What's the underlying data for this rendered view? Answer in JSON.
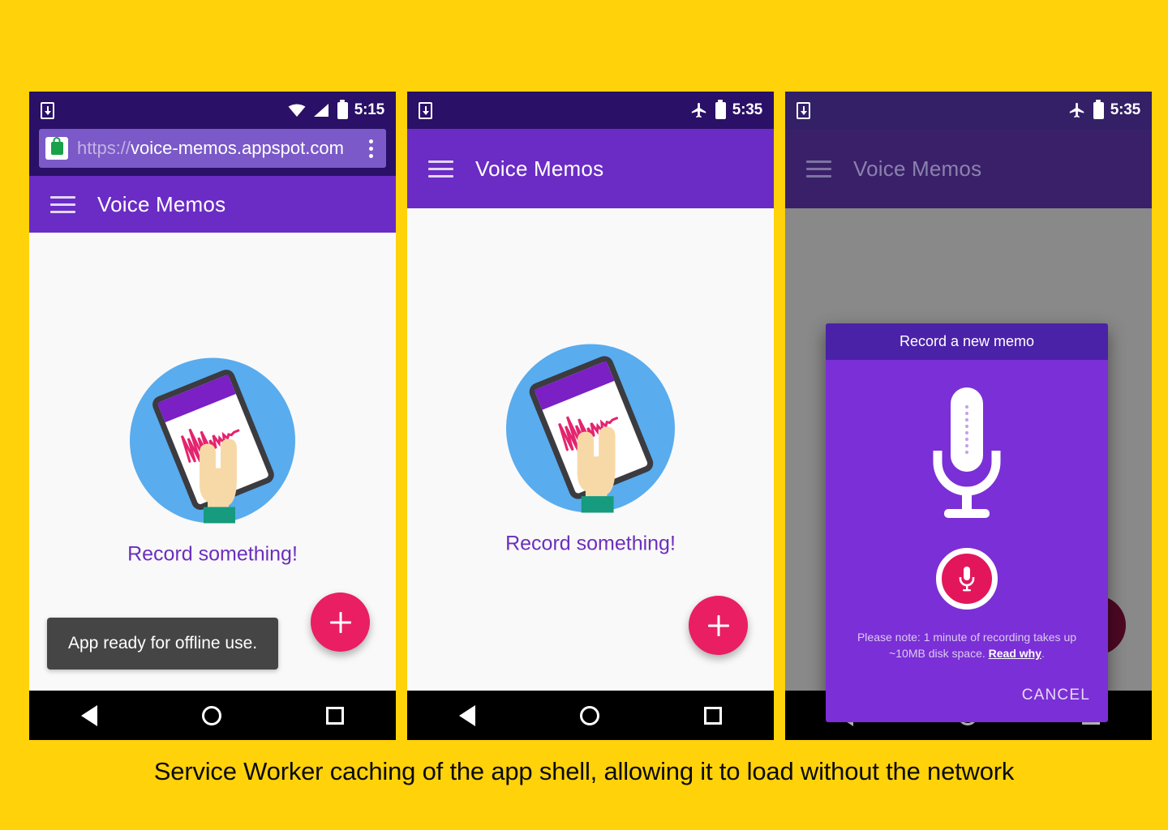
{
  "page": {
    "background_color": "#FFD20A",
    "caption": "Service Worker caching of the app shell, allowing it to load without the network"
  },
  "colors": {
    "yellow": "#FFD20A",
    "app_bar_purple": "#6A2CC4",
    "status_bar_purple": "#2A1066",
    "accent_pink": "#E91E63",
    "dialog_purple": "#7B2FD6",
    "dialog_header_purple": "#4A22A8",
    "toast_gray": "#454545",
    "illustration_blue": "#59ACEE",
    "illustration_wave_pink": "#E3246E",
    "illustration_skin": "#F7D9A8",
    "illustration_cuff_teal": "#169B7E"
  },
  "phones": [
    {
      "id": "phone-browser",
      "status_bar": {
        "download_icon": "download-icon",
        "icons": [
          "wifi-icon",
          "signal-icon",
          "battery-icon"
        ],
        "time": "5:15"
      },
      "browser": {
        "lock_icon": "lock-icon",
        "url_scheme": "https://",
        "url_host": "voice-memos.appspot.com",
        "menu_icon": "kebab-menu-icon"
      },
      "app_bar": {
        "menu_icon": "hamburger-icon",
        "title": "Voice Memos",
        "dimmed": false
      },
      "content": {
        "illustration": "hand-holding-phone-illustration",
        "empty_label": "Record something!"
      },
      "toast": "App ready for offline use.",
      "fab": {
        "icon": "plus-icon",
        "label": "Add memo",
        "dimmed": false
      },
      "dialog": null,
      "nav_bar": [
        "back-icon",
        "home-icon",
        "recents-icon"
      ]
    },
    {
      "id": "phone-offline",
      "status_bar": {
        "download_icon": "download-icon",
        "icons": [
          "airplane-mode-icon",
          "battery-icon"
        ],
        "time": "5:35"
      },
      "browser": null,
      "app_bar": {
        "menu_icon": "hamburger-icon",
        "title": "Voice Memos",
        "dimmed": false
      },
      "content": {
        "illustration": "hand-holding-phone-illustration",
        "empty_label": "Record something!"
      },
      "toast": null,
      "fab": {
        "icon": "plus-icon",
        "label": "Add memo",
        "dimmed": false
      },
      "dialog": null,
      "nav_bar": [
        "back-icon",
        "home-icon",
        "recents-icon"
      ]
    },
    {
      "id": "phone-record-dialog",
      "status_bar": {
        "download_icon": "download-icon",
        "icons": [
          "airplane-mode-icon",
          "battery-icon"
        ],
        "time": "5:35"
      },
      "browser": null,
      "app_bar": {
        "menu_icon": "hamburger-icon",
        "title": "Voice Memos",
        "dimmed": true
      },
      "content": {
        "illustration": null,
        "empty_label": null
      },
      "toast": null,
      "fab": {
        "icon": "plus-icon",
        "label": "Add memo",
        "dimmed": true
      },
      "dialog": {
        "title": "Record a new memo",
        "mic_icon": "microphone-icon",
        "record_button_icon": "microphone-icon",
        "note_line_1": "Please note: 1 minute of recording takes up",
        "note_line_2_prefix": "~10MB disk space. ",
        "note_link": "Read why",
        "note_suffix": ".",
        "cancel_label": "CANCEL"
      },
      "nav_bar": [
        "back-icon",
        "home-icon",
        "recents-icon"
      ]
    }
  ]
}
